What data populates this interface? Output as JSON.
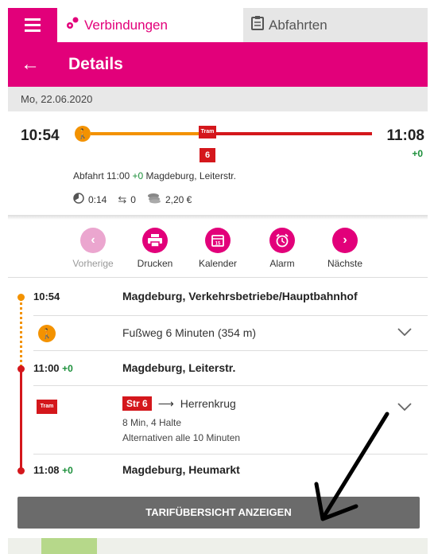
{
  "tabs": {
    "menu_icon": "hamburger-icon",
    "connections": {
      "label": "Verbindungen",
      "icon": "route-pin-icon"
    },
    "departures": {
      "label": "Abfahrten",
      "icon": "clipboard-icon"
    }
  },
  "header": {
    "back_icon": "arrow-left-icon",
    "title": "Details"
  },
  "date": "Mo, 22.06.2020",
  "summary": {
    "departure_time": "10:54",
    "arrival_time": "11:08",
    "arrival_delay": "+0",
    "tram_label": "Tram",
    "line": "6",
    "info_prefix": "Abfahrt 11:00",
    "info_delay": "+0",
    "info_station": "Magdeburg, Leiterstr.",
    "duration": "0:14",
    "transfers": "0",
    "price": "2,20 €"
  },
  "actions": [
    {
      "label": "Vorherige",
      "icon": "chevron-left-icon",
      "enabled": false
    },
    {
      "label": "Drucken",
      "icon": "printer-icon",
      "enabled": true
    },
    {
      "label": "Kalender",
      "icon": "calendar-icon",
      "enabled": true
    },
    {
      "label": "Alarm",
      "icon": "alarm-clock-icon",
      "enabled": true
    },
    {
      "label": "Nächste",
      "icon": "chevron-right-icon",
      "enabled": true
    }
  ],
  "timeline": {
    "stop1": {
      "time": "10:54",
      "station": "Magdeburg, Verkehrsbetriebe/Hauptbahnhof"
    },
    "walk": {
      "text": "Fußweg 6 Minuten (354 m)"
    },
    "stop2": {
      "time": "11:00",
      "delay": "+0",
      "station": "Magdeburg, Leiterstr."
    },
    "tram": {
      "icon_label": "Tram",
      "badge": "Str 6",
      "direction": "Herrenkrug",
      "details": "8 Min, 4 Halte",
      "alternatives": "Alternativen alle 10 Minuten"
    },
    "stop3": {
      "time": "11:08",
      "delay": "+0",
      "station": "Magdeburg, Heumarkt"
    }
  },
  "tarif_button": "TARIFÜBERSICHT ANZEIGEN",
  "colors": {
    "brand": "#e2007a",
    "tram": "#d4171c",
    "walk": "#f39200",
    "delay_ok": "#1b8f3a"
  }
}
